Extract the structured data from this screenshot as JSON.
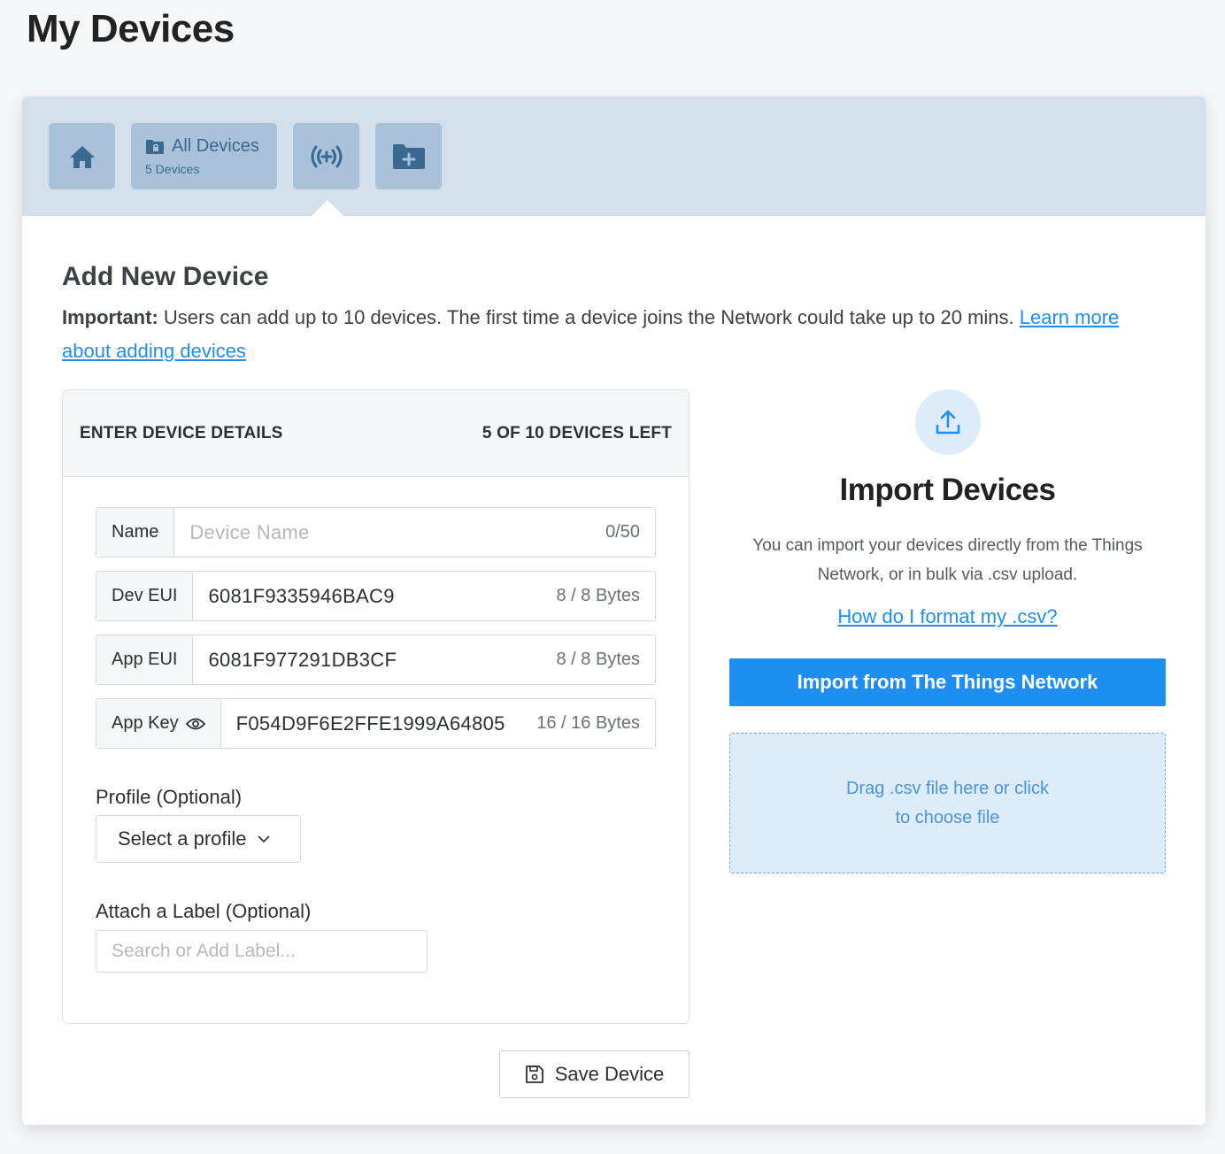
{
  "page": {
    "title": "My Devices"
  },
  "tabs": {
    "home_icon": "home-icon",
    "all_devices": {
      "label": "All Devices",
      "sub": "5 Devices",
      "icon": "folder-lock-icon"
    },
    "add_icon": "broadcast-add-icon",
    "folder_add_icon": "folder-plus-icon"
  },
  "section": {
    "title": "Add New Device",
    "important_prefix": "Important:",
    "important_text": " Users can add up to 10 devices. The first time a device joins the Network could take up to 20 mins. ",
    "learn_more": "Learn more about adding devices"
  },
  "form": {
    "header_left": "ENTER DEVICE DETAILS",
    "header_right": "5 OF 10 DEVICES LEFT",
    "name": {
      "label": "Name",
      "placeholder": "Device Name",
      "count": "0/50"
    },
    "dev_eui": {
      "label": "Dev EUI",
      "value": "6081F9335946BAC9",
      "count": "8 / 8 Bytes"
    },
    "app_eui": {
      "label": "App EUI",
      "value": "6081F977291DB3CF",
      "count": "8 / 8 Bytes"
    },
    "app_key": {
      "label": "App Key",
      "value": "F054D9F6E2FFE1999A64805",
      "count": "16 / 16 Bytes"
    },
    "profile_label": "Profile (Optional)",
    "profile_select": "Select a profile",
    "attach_label": "Attach a Label (Optional)",
    "label_placeholder": "Search or Add Label...",
    "save": "Save Device"
  },
  "import": {
    "title": "Import Devices",
    "desc": "You can import your devices directly from the Things Network, or in bulk via .csv upload.",
    "format_link": "How do I format my .csv?",
    "ttn_button": "Import from The Things Network",
    "drop_line1": "Drag .csv file here or click",
    "drop_line2": "to choose file"
  },
  "colors": {
    "accent": "#1e8ef0",
    "tabbar": "#d3e0ec",
    "tab": "#a9c2d9",
    "tab_icon": "#3a6990"
  }
}
